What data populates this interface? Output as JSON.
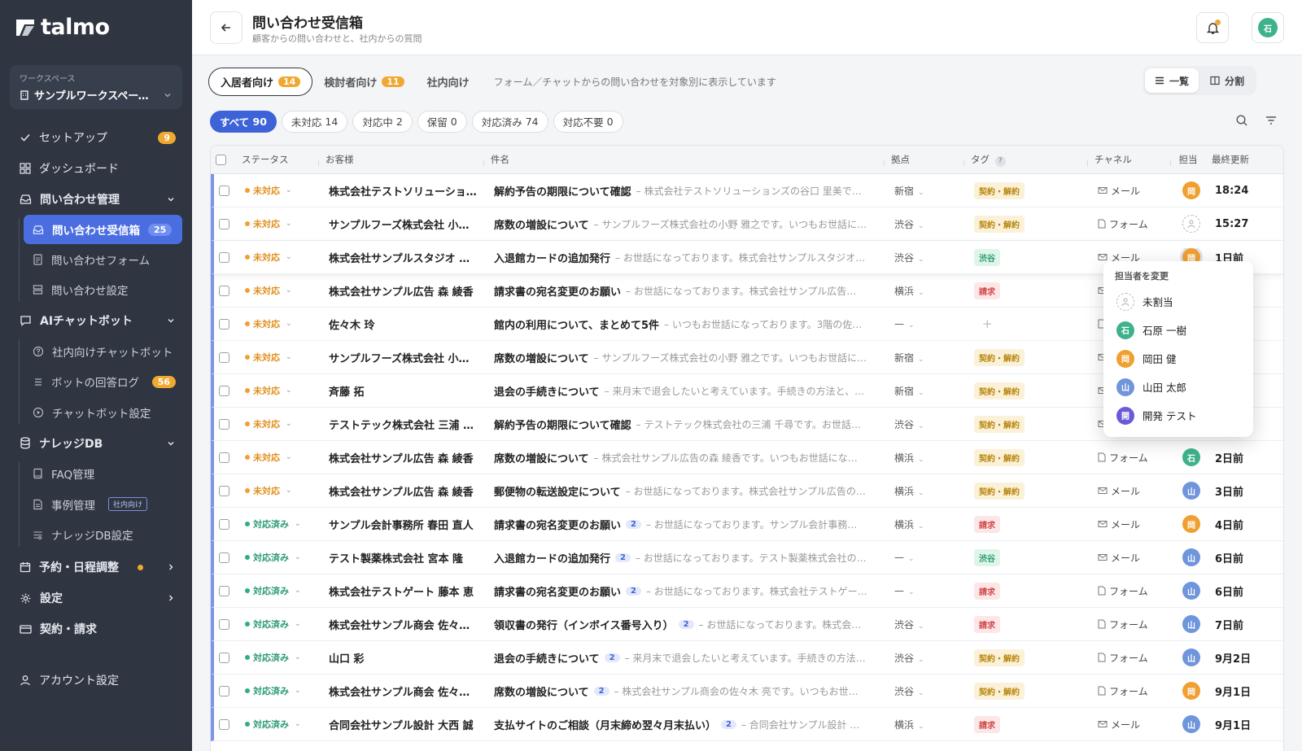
{
  "app": {
    "logo_text": "talmo"
  },
  "workspace": {
    "label": "ワークスペース",
    "name": "サンプルワークスペース…"
  },
  "nav": {
    "setup": {
      "label": "セットアップ",
      "badge": "9"
    },
    "dashboard": {
      "label": "ダッシュボード"
    },
    "inquiry_mgmt": {
      "label": "問い合わせ管理"
    },
    "inbox": {
      "label": "問い合わせ受信箱",
      "badge": "25"
    },
    "inquiry_form": {
      "label": "問い合わせフォーム"
    },
    "inquiry_settings": {
      "label": "問い合わせ設定"
    },
    "ai_chatbot": {
      "label": "AIチャットボット"
    },
    "internal_chatbot": {
      "label": "社内向けチャットボット"
    },
    "bot_log": {
      "label": "ボットの回答ログ",
      "badge": "56"
    },
    "chatbot_settings": {
      "label": "チャットボット設定"
    },
    "knowledge": {
      "label": "ナレッジDB"
    },
    "faq": {
      "label": "FAQ管理"
    },
    "cases": {
      "label": "事例管理",
      "tag": "社内向け"
    },
    "knowledge_settings": {
      "label": "ナレッジDB設定"
    },
    "booking": {
      "label": "予約・日程調整"
    },
    "settings": {
      "label": "設定"
    },
    "billing": {
      "label": "契約・請求"
    },
    "account": {
      "label": "アカウント設定"
    }
  },
  "header": {
    "title": "問い合わせ受信箱",
    "subtitle": "顧客からの問い合わせと、社内からの質問",
    "avatar": "石"
  },
  "audience_tabs": [
    {
      "label": "入居者向け",
      "count": "14"
    },
    {
      "label": "検討者向け",
      "count": "11"
    },
    {
      "label": "社内向け"
    }
  ],
  "audience_desc": "フォーム／チャットからの問い合わせを対象別に表示しています",
  "view": {
    "list": "一覧",
    "split": "分割"
  },
  "filters": [
    {
      "label": "すべて",
      "count": "90"
    },
    {
      "label": "未対応",
      "count": "14"
    },
    {
      "label": "対応中",
      "count": "2"
    },
    {
      "label": "保留",
      "count": "0"
    },
    {
      "label": "対応済み",
      "count": "74"
    },
    {
      "label": "対応不要",
      "count": "0"
    }
  ],
  "columns": {
    "status": "ステータス",
    "customer": "お客様",
    "subject": "件名",
    "location": "拠点",
    "tag": "タグ",
    "channel": "チャネル",
    "assignee": "担当",
    "updated": "最終更新"
  },
  "rows": [
    {
      "status": "未対応",
      "customer": "株式会社テストソリューショ…",
      "subject": "解約予告の期限について確認",
      "preview": "– 株式会社テストソリューションズの谷口 里美で…",
      "location": "新宿",
      "tag": "契約・解約",
      "channel": "メール",
      "assignee": "岡",
      "updated": "18:24"
    },
    {
      "status": "未対応",
      "customer": "サンプルフーズ株式会社 小…",
      "subject": "席数の増設について",
      "preview": "– サンプルフーズ株式会社の小野 雅之です。いつもお世話に…",
      "location": "渋谷",
      "tag": "契約・解約",
      "channel": "フォーム",
      "assignee": "",
      "updated": "15:27"
    },
    {
      "status": "未対応",
      "customer": "株式会社サンプルスタジオ …",
      "subject": "入退館カードの追加発行",
      "preview": "– お世話になっております。株式会社サンプルスタジオ…",
      "location": "渋谷",
      "tag": "渋谷",
      "channel": "メール",
      "assignee": "岡",
      "updated": "1日前"
    },
    {
      "status": "未対応",
      "customer": "株式会社サンプル広告 森 綾香",
      "subject": "請求書の宛名変更のお願い",
      "preview": "– お世話になっております。株式会社サンプル広告…",
      "location": "横浜",
      "tag": "請求",
      "channel": "",
      "assignee": "",
      "updated": ""
    },
    {
      "status": "未対応",
      "customer": "佐々木 玲",
      "subject": "館内の利用について、まとめて5件",
      "preview": "– いつもお世話になっております。3階の佐…",
      "location": "—",
      "tag": "",
      "channel": "",
      "assignee": "",
      "updated": ""
    },
    {
      "status": "未対応",
      "customer": "サンプルフーズ株式会社 小…",
      "subject": "席数の増設について",
      "preview": "– サンプルフーズ株式会社の小野 雅之です。いつもお世話に…",
      "location": "新宿",
      "tag": "契約・解約",
      "channel": "",
      "assignee": "",
      "updated": ""
    },
    {
      "status": "未対応",
      "customer": "斉藤 拓",
      "subject": "退会の手続きについて",
      "preview": "– 来月末で退会したいと考えています。手続きの方法と、…",
      "location": "新宿",
      "tag": "契約・解約",
      "channel": "",
      "assignee": "",
      "updated": ""
    },
    {
      "status": "未対応",
      "customer": "テストテック株式会社 三浦 …",
      "subject": "解約予告の期限について確認",
      "preview": "– テストテック株式会社の三浦 千尋です。お世話…",
      "location": "渋谷",
      "tag": "契約・解約",
      "channel": "",
      "assignee": "",
      "updated": ""
    },
    {
      "status": "未対応",
      "customer": "株式会社サンプル広告 森 綾香",
      "subject": "席数の増設について",
      "preview": "– 株式会社サンプル広告の森 綾香です。いつもお世話にな…",
      "location": "横浜",
      "tag": "契約・解約",
      "channel": "フォーム",
      "assignee": "石",
      "updated": "2日前"
    },
    {
      "status": "未対応",
      "customer": "株式会社サンプル広告 森 綾香",
      "subject": "郵便物の転送設定について",
      "preview": "– お世話になっております。株式会社サンプル広告の…",
      "location": "横浜",
      "tag": "契約・解約",
      "channel": "メール",
      "assignee": "山",
      "updated": "3日前"
    },
    {
      "status": "対応済み",
      "customer": "サンプル会計事務所 春田 直人",
      "subject": "請求書の宛名変更のお願い",
      "count": "2",
      "preview": "– お世話になっております。サンプル会計事務…",
      "location": "横浜",
      "tag": "請求",
      "channel": "メール",
      "assignee": "岡",
      "updated": "4日前"
    },
    {
      "status": "対応済み",
      "customer": "テスト製薬株式会社 宮本 隆",
      "subject": "入退館カードの追加発行",
      "count": "2",
      "preview": "– お世話になっております。テスト製薬株式会社の…",
      "location": "—",
      "tag": "渋谷",
      "channel": "メール",
      "assignee": "山",
      "updated": "6日前"
    },
    {
      "status": "対応済み",
      "customer": "株式会社テストゲート 藤本 恵",
      "subject": "請求書の宛名変更のお願い",
      "count": "2",
      "preview": "– お世話になっております。株式会社テストゲー…",
      "location": "—",
      "tag": "請求",
      "channel": "フォーム",
      "assignee": "山",
      "updated": "6日前"
    },
    {
      "status": "対応済み",
      "customer": "株式会社サンプル商会 佐々…",
      "subject": "領収書の発行（インボイス番号入り）",
      "count": "2",
      "preview": "– お世話になっております。株式会…",
      "location": "渋谷",
      "tag": "請求",
      "channel": "フォーム",
      "assignee": "山",
      "updated": "7日前"
    },
    {
      "status": "対応済み",
      "customer": "山口 彩",
      "subject": "退会の手続きについて",
      "count": "2",
      "preview": "– 来月末で退会したいと考えています。手続きの方法…",
      "location": "渋谷",
      "tag": "契約・解約",
      "channel": "フォーム",
      "assignee": "山",
      "updated": "9月2日"
    },
    {
      "status": "対応済み",
      "customer": "株式会社サンプル商会 佐々…",
      "subject": "席数の増設について",
      "count": "2",
      "preview": "– 株式会社サンプル商会の佐々木 亮です。いつもお世…",
      "location": "渋谷",
      "tag": "契約・解約",
      "channel": "フォーム",
      "assignee": "岡",
      "updated": "9月1日"
    },
    {
      "status": "対応済み",
      "customer": "合同会社サンプル設計 大西 誠",
      "subject": "支払サイトのご相談（月末締め翌々月末払い）",
      "count": "2",
      "preview": "– 合同会社サンプル設計 …",
      "location": "横浜",
      "tag": "請求",
      "channel": "メール",
      "assignee": "山",
      "updated": "9月1日"
    }
  ],
  "assignee_menu": {
    "title": "担当者を変更",
    "items": [
      {
        "label": "未割当",
        "avatar": ""
      },
      {
        "label": "石原 一樹",
        "avatar": "石"
      },
      {
        "label": "岡田 健",
        "avatar": "岡"
      },
      {
        "label": "山田 太郎",
        "avatar": "山"
      },
      {
        "label": "開発 テスト",
        "avatar": "開"
      }
    ]
  },
  "colors": {
    "accent": "#3e63d8",
    "sidebar": "#2f3541",
    "pending": "#f0a030",
    "done": "#2fae7c"
  }
}
